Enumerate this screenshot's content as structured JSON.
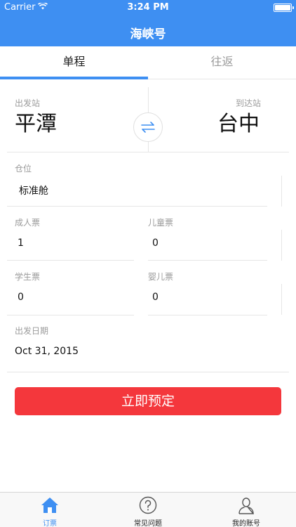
{
  "status_bar": {
    "carrier": "Carrier",
    "time": "3:24 PM"
  },
  "nav": {
    "title": "海峡号"
  },
  "tabs": {
    "one_way": "单程",
    "round_trip": "往返"
  },
  "stations": {
    "from_label": "出发站",
    "from_value": "平潭",
    "to_label": "到达站",
    "to_value": "台中"
  },
  "form": {
    "class_label": "仓位",
    "class_value": "标准舱",
    "adult_label": "成人票",
    "adult_value": "1",
    "child_label": "儿童票",
    "child_value": "0",
    "student_label": "学生票",
    "student_value": "0",
    "infant_label": "婴儿票",
    "infant_value": "0",
    "date_label": "出发日期",
    "date_value": "Oct 31, 2015"
  },
  "actions": {
    "book_label": "立即预定"
  },
  "tab_bar": {
    "items": [
      {
        "label": "订票",
        "icon": "home-icon"
      },
      {
        "label": "常见问题",
        "icon": "question-icon"
      },
      {
        "label": "我的账号",
        "icon": "user-icon"
      }
    ]
  },
  "colors": {
    "primary": "#3e8ff2",
    "danger": "#f4373c"
  }
}
